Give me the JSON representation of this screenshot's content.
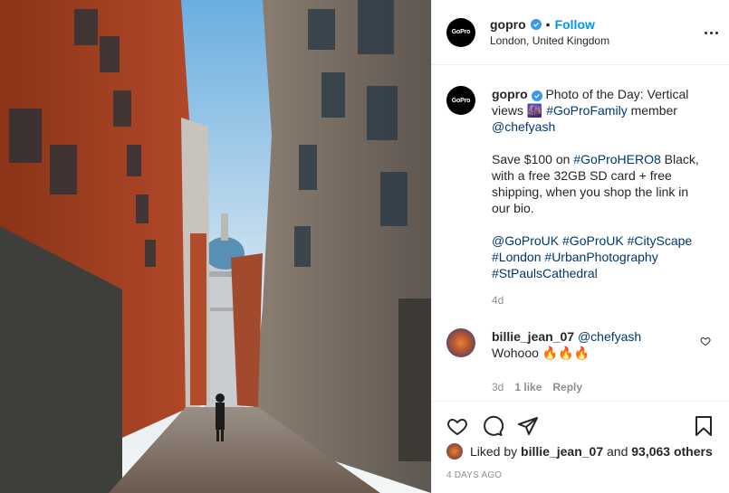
{
  "header": {
    "avatar_logo": "GoPro",
    "username": "gopro",
    "separator": "•",
    "follow_label": "Follow",
    "location": "London, United Kingdom"
  },
  "caption": {
    "username": "gopro",
    "line1": "Photo of the Day: Vertical views 🌆 ",
    "tag_family": "#GoProFamily",
    "member_word": " member",
    "mention": "@chefyash",
    "para2_a": "Save $100 on ",
    "tag_hero": "#GoProHERO8",
    "para2_b": " Black, with a free 32GB SD card + free shipping, when you shop the link in our bio.",
    "tags": [
      "@GoProUK",
      "#GoProUK",
      "#CityScape",
      "#London",
      "#UrbanPhotography",
      "#StPaulsCathedral"
    ],
    "age": "4d"
  },
  "comment": {
    "username": "billie_jean_07",
    "mention": "@chefyash",
    "text": "Wohooo 🔥🔥🔥",
    "age": "3d",
    "likes": "1 like",
    "reply": "Reply"
  },
  "likes": {
    "prefix": "Liked by ",
    "user": "billie_jean_07",
    "middle": " and ",
    "others": "93,063 others"
  },
  "date": "4 DAYS AGO",
  "colors": {
    "accent": "#0095f6",
    "link": "#00376b",
    "muted": "#8e8e8e",
    "verified": "#3897f0"
  }
}
